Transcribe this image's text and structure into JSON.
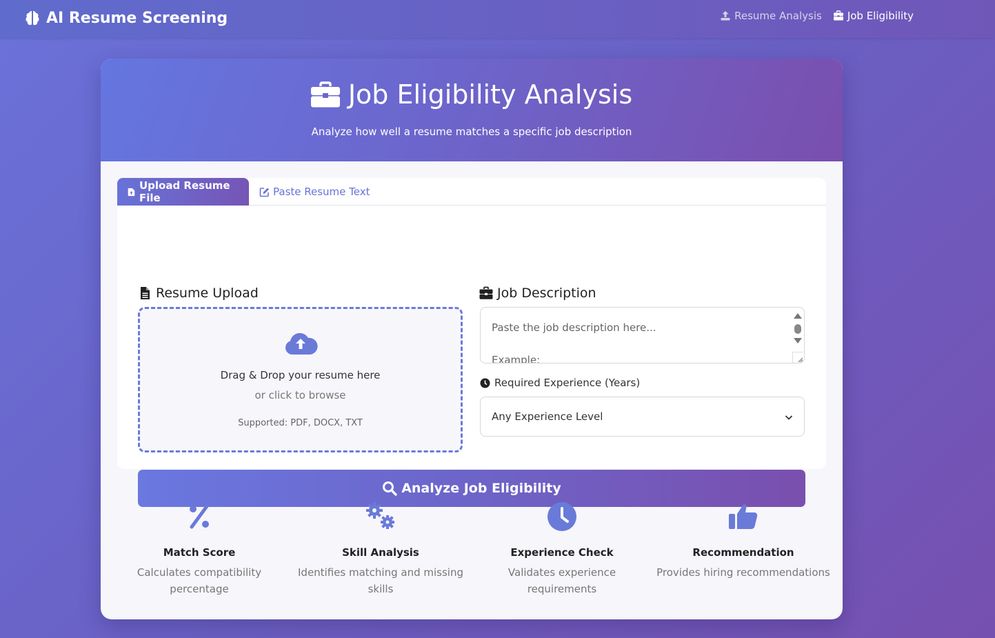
{
  "navbar": {
    "brand": "AI Resume Screening",
    "links": [
      {
        "label": "Resume Analysis",
        "icon": "upload-icon"
      },
      {
        "label": "Job Eligibility",
        "icon": "briefcase-icon"
      }
    ]
  },
  "hero": {
    "title": "Job Eligibility Analysis",
    "subtitle": "Analyze how well a resume matches a specific job description"
  },
  "tabs": [
    {
      "label": "Upload Resume File",
      "icon": "file-upload-icon",
      "active": true
    },
    {
      "label": "Paste Resume Text",
      "icon": "edit-icon",
      "active": false
    }
  ],
  "resume_upload": {
    "title": "Resume Upload",
    "dropzone_title": "Drag & Drop your resume here",
    "dropzone_sub": "or click to browse",
    "supported": "Supported: PDF, DOCX, TXT"
  },
  "job_description": {
    "title": "Job Description",
    "placeholder_line1": "Paste the job description here...",
    "placeholder_line2": "Example:"
  },
  "experience": {
    "label": "Required Experience (Years)",
    "selected": "Any Experience Level"
  },
  "analyze_button": "Analyze Job Eligibility",
  "features": [
    {
      "title": "Match Score",
      "desc": "Calculates compatibility percentage",
      "icon": "percent-icon"
    },
    {
      "title": "Skill Analysis",
      "desc": "Identifies matching and missing skills",
      "icon": "cogs-icon"
    },
    {
      "title": "Experience Check",
      "desc": "Validates experience requirements",
      "icon": "clock-icon"
    },
    {
      "title": "Recommendation",
      "desc": "Provides hiring recommendations",
      "icon": "thumbs-up-icon"
    }
  ],
  "colors": {
    "accent": "#6a78e0",
    "accent_end": "#7a4fae",
    "background": "#6a60c4"
  }
}
